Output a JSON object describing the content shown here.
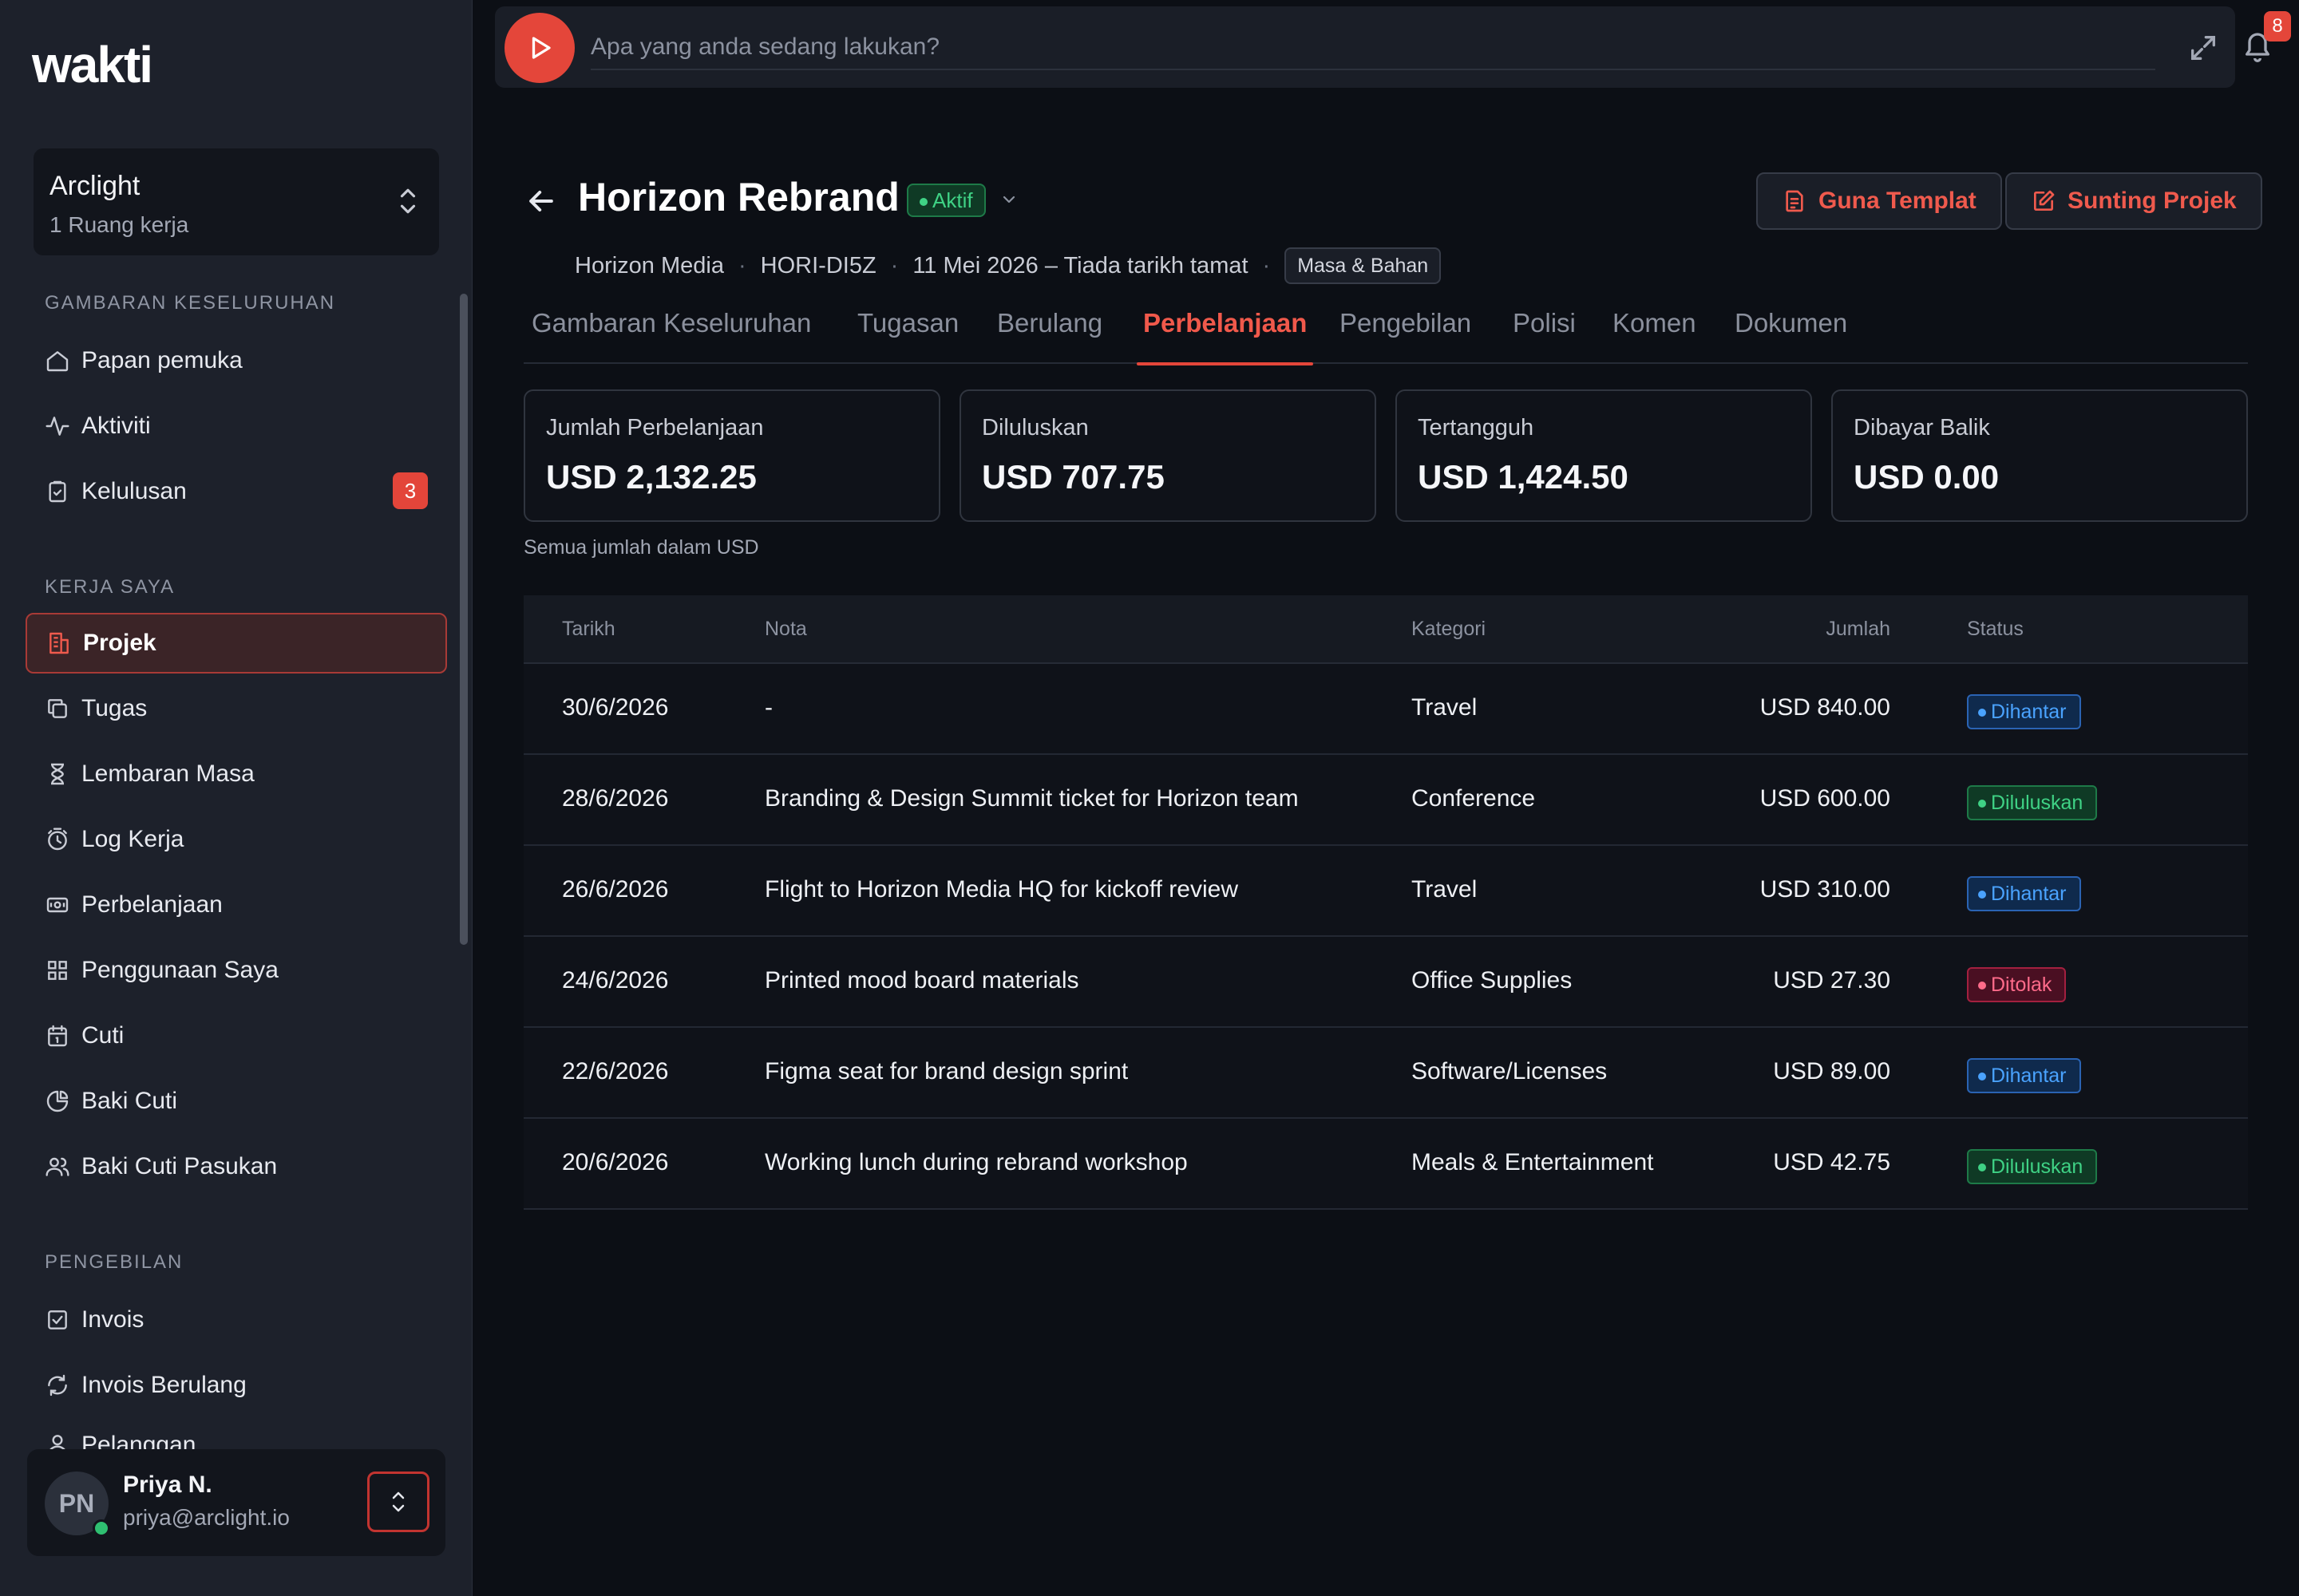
{
  "app": {
    "logo": "wakti"
  },
  "workspace": {
    "name": "Arclight",
    "subtitle": "1 Ruang kerja"
  },
  "sidebar": {
    "sections": [
      {
        "label": "GAMBARAN KESELURUHAN"
      },
      {
        "label": "KERJA SAYA"
      },
      {
        "label": "PENGEBILAN"
      }
    ],
    "overview": [
      {
        "label": "Papan pemuka",
        "icon": "home-icon"
      },
      {
        "label": "Aktiviti",
        "icon": "activity-icon"
      },
      {
        "label": "Kelulusan",
        "icon": "clipboard-check-icon",
        "badge": "3"
      }
    ],
    "mywork": [
      {
        "label": "Projek",
        "icon": "building-icon",
        "active": true
      },
      {
        "label": "Tugas",
        "icon": "copy-icon"
      },
      {
        "label": "Lembaran Masa",
        "icon": "hourglass-icon"
      },
      {
        "label": "Log Kerja",
        "icon": "timer-icon"
      },
      {
        "label": "Perbelanjaan",
        "icon": "banknote-icon"
      },
      {
        "label": "Penggunaan Saya",
        "icon": "grid-icon"
      },
      {
        "label": "Cuti",
        "icon": "calendar-icon"
      },
      {
        "label": "Baki Cuti",
        "icon": "pie-chart-icon"
      },
      {
        "label": "Baki Cuti Pasukan",
        "icon": "users-icon"
      }
    ],
    "billing": [
      {
        "label": "Invois",
        "icon": "check-square-icon"
      },
      {
        "label": "Invois Berulang",
        "icon": "refresh-icon"
      },
      {
        "label": "Pelanggan",
        "icon": "user-icon"
      }
    ]
  },
  "user": {
    "initials": "PN",
    "name": "Priya N.",
    "email": "priya@arclight.io"
  },
  "topbar": {
    "placeholder": "Apa yang anda sedang lakukan?",
    "notifications": "8"
  },
  "project": {
    "title": "Horizon Rebrand",
    "status": "Aktif",
    "client": "Horizon Media",
    "code": "HORI-DI5Z",
    "dates": "11 Mei 2026 – Tiada tarikh tamat",
    "billing_type": "Masa & Bahan"
  },
  "actions": {
    "use_template": "Guna Templat",
    "edit_project": "Sunting Projek"
  },
  "tabs": [
    "Gambaran Keseluruhan",
    "Tugasan",
    "Berulang",
    "Perbelanjaan",
    "Pengebilan",
    "Polisi",
    "Komen",
    "Dokumen"
  ],
  "active_tab": "Perbelanjaan",
  "summary": [
    {
      "label": "Jumlah Perbelanjaan",
      "value": "USD 2,132.25"
    },
    {
      "label": "Diluluskan",
      "value": "USD 707.75"
    },
    {
      "label": "Tertangguh",
      "value": "USD 1,424.50"
    },
    {
      "label": "Dibayar Balik",
      "value": "USD 0.00"
    }
  ],
  "amount_note": "Semua jumlah dalam USD",
  "table": {
    "headers": {
      "date": "Tarikh",
      "note": "Nota",
      "category": "Kategori",
      "amount": "Jumlah",
      "status": "Status"
    },
    "rows": [
      {
        "date": "30/6/2026",
        "note": "-",
        "category": "Travel",
        "amount": "USD 840.00",
        "status": "Dihantar",
        "status_type": "submitted"
      },
      {
        "date": "28/6/2026",
        "note": "Branding & Design Summit ticket for Horizon team",
        "category": "Conference",
        "amount": "USD 600.00",
        "status": "Diluluskan",
        "status_type": "approved"
      },
      {
        "date": "26/6/2026",
        "note": "Flight to Horizon Media HQ for kickoff review",
        "category": "Travel",
        "amount": "USD 310.00",
        "status": "Dihantar",
        "status_type": "submitted"
      },
      {
        "date": "24/6/2026",
        "note": "Printed mood board materials",
        "category": "Office Supplies",
        "amount": "USD 27.30",
        "status": "Ditolak",
        "status_type": "rejected"
      },
      {
        "date": "22/6/2026",
        "note": "Figma seat for brand design sprint",
        "category": "Software/Licenses",
        "amount": "USD 89.00",
        "status": "Dihantar",
        "status_type": "submitted"
      },
      {
        "date": "20/6/2026",
        "note": "Working lunch during rebrand workshop",
        "category": "Meals & Entertainment",
        "amount": "USD 42.75",
        "status": "Diluluskan",
        "status_type": "approved"
      }
    ]
  },
  "colors": {
    "accent": "#e4463a",
    "submitted_fg": "#4aa3ff",
    "submitted_bg": "#0f2a4d",
    "submitted_border": "#2a63b3",
    "approved_fg": "#3fd285",
    "approved_bg": "#0f3a25",
    "approved_border": "#1e7a48",
    "rejected_fg": "#ff6b8a",
    "rejected_bg": "#4a0f22",
    "rejected_border": "#a3203f"
  }
}
